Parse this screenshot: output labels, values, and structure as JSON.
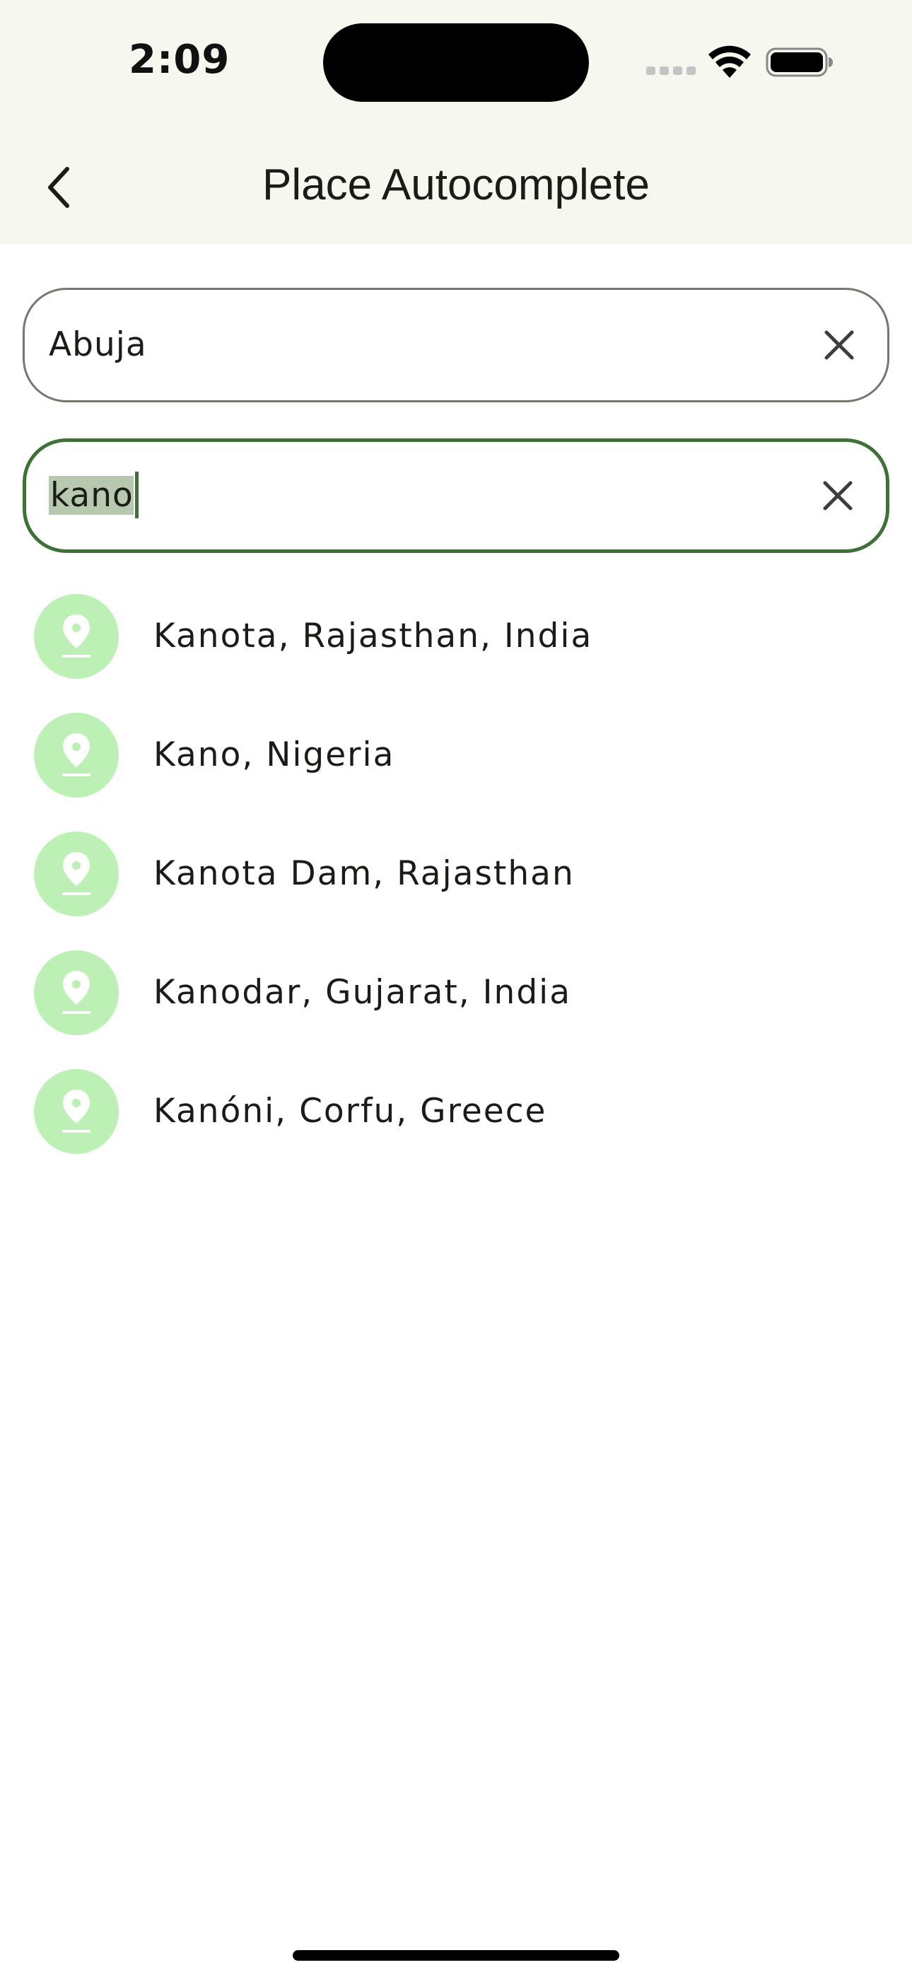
{
  "status_bar": {
    "time": "2:09",
    "icons": [
      "cellular-signal-icon",
      "wifi-icon",
      "battery-icon"
    ]
  },
  "app_bar": {
    "back_icon": "chevron-left-icon",
    "title": "Place Autocomplete"
  },
  "fields": {
    "origin": {
      "value": "Abuja",
      "clear_icon": "close-icon"
    },
    "destination": {
      "value": "kano",
      "clear_icon": "close-icon",
      "focused": true
    }
  },
  "suggestions": [
    {
      "label": "Kanota, Rajasthan, India",
      "icon": "place-pin-icon"
    },
    {
      "label": "Kano, Nigeria",
      "icon": "place-pin-icon"
    },
    {
      "label": "Kanota Dam, Rajasthan",
      "icon": "place-pin-icon"
    },
    {
      "label": "Kanodar, Gujarat, India",
      "icon": "place-pin-icon"
    },
    {
      "label": "Kanóni, Corfu, Greece",
      "icon": "place-pin-icon"
    }
  ],
  "colors": {
    "app_bar_bg": "#f6f8f0",
    "focus_border": "#3e7038",
    "outline_border": "#75786e",
    "suggestion_avatar_bg": "#bdf0b4",
    "text_selection_bg": "#b6c9ae"
  }
}
